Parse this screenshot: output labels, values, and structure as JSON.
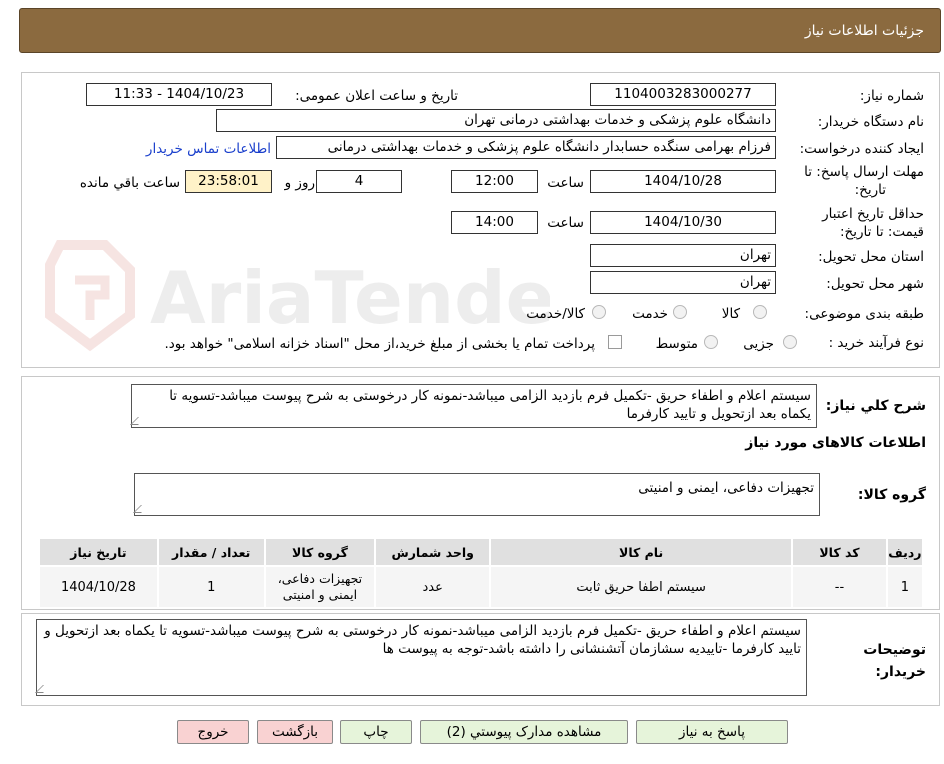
{
  "header": {
    "title": "جزئیات اطلاعات نیاز"
  },
  "form": {
    "need_number_label": "شماره نیاز:",
    "need_number": "1104003283000277",
    "announce_label": "تاریخ و ساعت اعلان عمومی:",
    "announce_value": "1404/10/23 - 11:33",
    "buyer_org_label": "نام دستگاه خریدار:",
    "buyer_org": "دانشگاه علوم پزشکی و خدمات بهداشتی درمانی تهران",
    "requester_label": "ایجاد کننده درخواست:",
    "requester": "فرزام بهرامی سنگده حسابدار دانشگاه علوم پزشکی و خدمات بهداشتی درمانی",
    "contact_link": "اطلاعات تماس خریدار",
    "deadline_label_1": "مهلت ارسال پاسخ: تا",
    "deadline_label_2": "تاریخ:",
    "deadline_date": "1404/10/28",
    "time_label": "ساعت",
    "deadline_time": "12:00",
    "days_value": "4",
    "days_label": "روز و",
    "remaining_time": "23:58:01",
    "remaining_label": "ساعت باقي مانده",
    "validity_label_1": "حداقل تاریخ اعتبار",
    "validity_label_2": "قیمت: تا تاریخ:",
    "validity_date": "1404/10/30",
    "validity_time": "14:00",
    "province_label": "استان محل تحویل:",
    "province": "تهران",
    "city_label": "شهر محل تحویل:",
    "city": "تهران",
    "category_label": "طبقه بندی موضوعی:",
    "category_options": [
      "کالا",
      "خدمت",
      "کالا/خدمت"
    ],
    "process_label": "نوع فرآیند خرید :",
    "process_options": [
      "جزیی",
      "متوسط"
    ],
    "payment_note": "پرداخت تمام یا بخشی از مبلغ خرید،از محل \"اسناد خزانه اسلامی\" خواهد بود."
  },
  "summary": {
    "label": "شرح کلي نیاز:",
    "text": "سیستم اعلام و اطفاء حریق  -تکمیل فرم بازدید الزامی میباشد-نمونه کار درخوستی به شرح پیوست میباشد-تسویه تا یکماه بعد ازتحویل و  تایید کارفرما"
  },
  "goods": {
    "section_title": "اطلاعات کالاهای مورد نیاز",
    "group_label": "گروه کالا:",
    "group_value": "تجهیزات دفاعی، ایمنی و امنیتی",
    "columns": [
      "ردیف",
      "کد کالا",
      "نام کالا",
      "واحد شمارش",
      "گروه کالا",
      "تعداد / مقدار",
      "تاریخ نیاز"
    ],
    "rows": [
      [
        "1",
        "--",
        "سیستم اطفا حریق ثابت",
        "عدد",
        "تجهیزات دفاعی، ایمنی و امنیتی",
        "1",
        "1404/10/28"
      ]
    ]
  },
  "buyer_notes": {
    "label": "توضیحات خریدار:",
    "text": "سیستم اعلام و اطفاء حریق  -تکمیل فرم بازدید الزامی میباشد-نمونه کار درخوستی به شرح پیوست میباشد-تسویه تا یکماه بعد ازتحویل و  تایید کارفرما -تاییدیه سشازمان آتشنشانی را داشته باشد-توجه به پیوست ها"
  },
  "buttons": {
    "reply": "پاسخ به نیاز",
    "attachments": "مشاهده مدارک پیوستي (2)",
    "print": "چاپ",
    "back": "بازگشت",
    "exit": "خروج"
  },
  "colors": {
    "header": "#8b6a3f",
    "link": "#1a3fcc",
    "countdown": "#fff2c8"
  }
}
